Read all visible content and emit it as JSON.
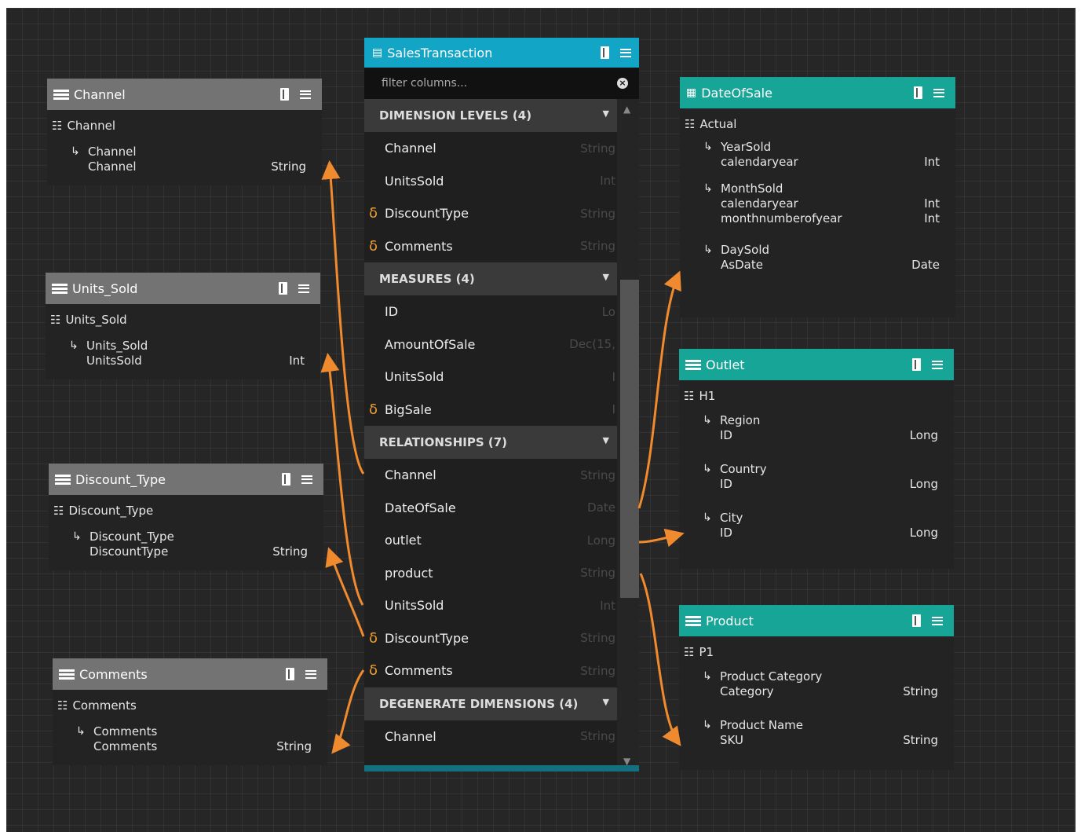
{
  "fact_table": {
    "title": "SalesTransaction",
    "filter_placeholder": "filter columns...",
    "sections": [
      {
        "label": "DIMENSION LEVELS (4)",
        "fields": [
          {
            "name": "Channel",
            "type": "String",
            "calc": false
          },
          {
            "name": "UnitsSold",
            "type": "Int",
            "calc": false
          },
          {
            "name": "DiscountType",
            "type": "String",
            "calc": true
          },
          {
            "name": "Comments",
            "type": "String",
            "calc": true
          }
        ]
      },
      {
        "label": "MEASURES (4)",
        "fields": [
          {
            "name": "ID",
            "type": "Lo",
            "calc": false
          },
          {
            "name": "AmountOfSale",
            "type": "Dec(15,",
            "calc": false
          },
          {
            "name": "UnitsSold",
            "type": "I",
            "calc": false
          },
          {
            "name": "BigSale",
            "type": "I",
            "calc": true
          }
        ]
      },
      {
        "label": "RELATIONSHIPS (7)",
        "fields": [
          {
            "name": "Channel",
            "type": "String",
            "calc": false
          },
          {
            "name": "DateOfSale",
            "type": "Date",
            "calc": false
          },
          {
            "name": "outlet",
            "type": "Long",
            "calc": false
          },
          {
            "name": "product",
            "type": "String",
            "calc": false
          },
          {
            "name": "UnitsSold",
            "type": "Int",
            "calc": false
          },
          {
            "name": "DiscountType",
            "type": "String",
            "calc": true
          },
          {
            "name": "Comments",
            "type": "String",
            "calc": true
          }
        ]
      },
      {
        "label": "DEGENERATE DIMENSIONS (4)",
        "fields": [
          {
            "name": "Channel",
            "type": "String",
            "calc": false
          }
        ]
      }
    ]
  },
  "calc_symbol": "δ",
  "dimensions": {
    "channel": {
      "title": "Channel",
      "hierarchy": "Channel",
      "level_name": "Channel",
      "attr": "Channel",
      "type": "String"
    },
    "units_sold": {
      "title": "Units_Sold",
      "hierarchy": "Units_Sold",
      "level_name": "Units_Sold",
      "attr": "UnitsSold",
      "type": "Int"
    },
    "discount_type": {
      "title": "Discount_Type",
      "hierarchy": "Discount_Type",
      "level_name": "Discount_Type",
      "attr": "DiscountType",
      "type": "String"
    },
    "comments": {
      "title": "Comments",
      "hierarchy": "Comments",
      "level_name": "Comments",
      "attr": "Comments",
      "type": "String"
    },
    "date_of_sale": {
      "title": "DateOfSale",
      "hierarchy": "Actual",
      "levels": [
        {
          "name": "YearSold",
          "attrs": [
            {
              "name": "calendaryear",
              "type": "Int"
            }
          ]
        },
        {
          "name": "MonthSold",
          "attrs": [
            {
              "name": "calendaryear",
              "type": "Int"
            },
            {
              "name": "monthnumberofyear",
              "type": "Int"
            }
          ]
        },
        {
          "name": "DaySold",
          "attrs": [
            {
              "name": "AsDate",
              "type": "Date"
            }
          ]
        }
      ]
    },
    "outlet": {
      "title": "Outlet",
      "hierarchy": "H1",
      "levels": [
        {
          "name": "Region",
          "attrs": [
            {
              "name": "ID",
              "type": "Long"
            }
          ]
        },
        {
          "name": "Country",
          "attrs": [
            {
              "name": "ID",
              "type": "Long"
            }
          ]
        },
        {
          "name": "City",
          "attrs": [
            {
              "name": "ID",
              "type": "Long"
            }
          ]
        }
      ]
    },
    "product": {
      "title": "Product",
      "hierarchy": "P1",
      "levels": [
        {
          "name": "Product Category",
          "attrs": [
            {
              "name": "Category",
              "type": "String"
            }
          ]
        },
        {
          "name": "Product Name",
          "attrs": [
            {
              "name": "SKU",
              "type": "String"
            }
          ]
        }
      ]
    }
  },
  "colors": {
    "fact_header": "#13a5c6",
    "dim_header_gray": "#737373",
    "dim_header_teal": "#16a596",
    "link": "#f08a2e",
    "calc": "#f0a030"
  }
}
